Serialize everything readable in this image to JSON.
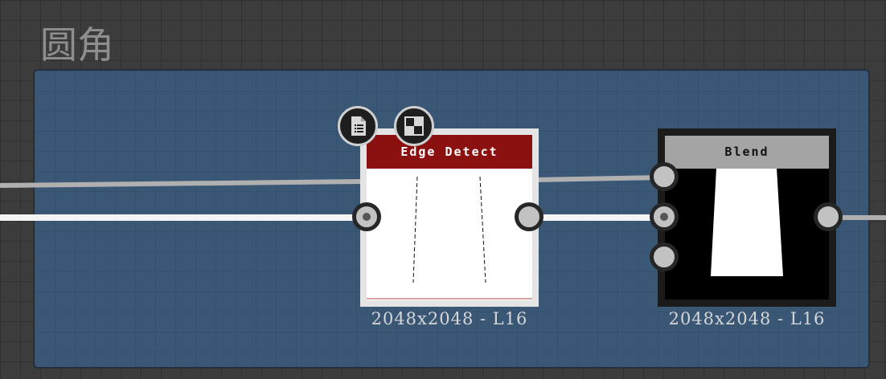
{
  "frame": {
    "title": "圆角",
    "color": "#3a5776"
  },
  "nodes": [
    {
      "id": "edge-detect",
      "title": "Edge Detect",
      "header_color": "#8b1010",
      "resolution": "2048x2048 - L16"
    },
    {
      "id": "blend",
      "title": "Blend",
      "header_color": "#a4a4a4",
      "resolution": "2048x2048 - L16"
    }
  ],
  "toolbar": {
    "icons": [
      "document-list-icon",
      "checker-icon"
    ]
  }
}
